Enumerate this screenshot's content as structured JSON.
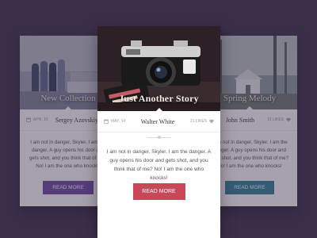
{
  "colors": {
    "background": "#3b2f4a",
    "left_button": "#6b4aa0",
    "center_button": "#c8485a",
    "right_button": "#2f7f98",
    "center_accent": "#c8485a"
  },
  "cards": [
    {
      "hero_title": "New Collection",
      "date": "APR, 16",
      "author": "Sergey Azovskiy",
      "likes": "",
      "body": "I am not in danger, Skyler. I am the danger. A guy opens his door and gets shot, and you think that of me? No! I am the one who knocks!",
      "button": "READ MORE",
      "hero_icon": "fabric-rolls-image"
    },
    {
      "hero_title": "Just Another Story",
      "date": "MAY, 14",
      "author": "Walter White",
      "likes": "21 LIKES",
      "body": "I am not in danger, Skyler. I am the danger. A guy opens his door and gets shot, and you think that of me? No! I am the one who knocks!",
      "button": "READ MORE",
      "hero_icon": "camera-image"
    },
    {
      "hero_title": "Spring Melody",
      "date": "",
      "author": "John Smith",
      "likes": "13 LIKES",
      "body": "I am not in danger, Skyler. I am the danger. A guy opens his door and gets shot, and you think that of me? No! I am the one who knocks!",
      "button": "READ MORE",
      "hero_icon": "forest-house-image"
    }
  ]
}
